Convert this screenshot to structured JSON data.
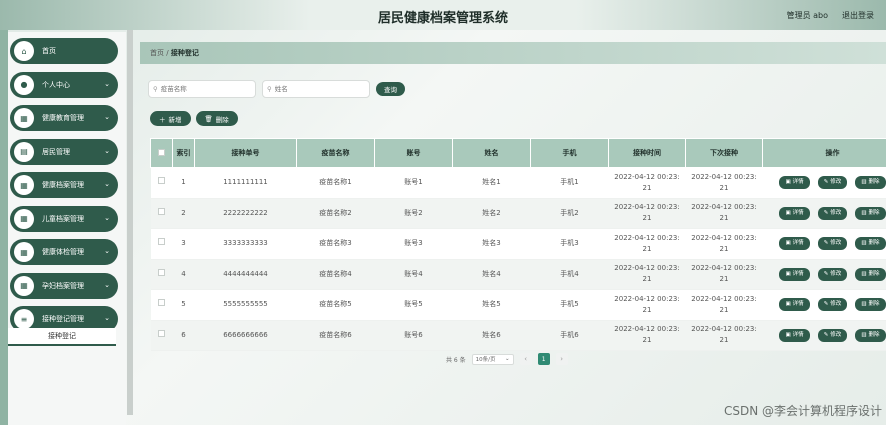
{
  "header": {
    "title": "居民健康档案管理系统",
    "user": "管理员 abo",
    "logout": "退出登录"
  },
  "sidebar": {
    "items": [
      {
        "label": "首页",
        "icon": "home-icon",
        "glyph": "⌂",
        "chevron": false
      },
      {
        "label": "个人中心",
        "icon": "user-icon",
        "glyph": "●",
        "chevron": true
      },
      {
        "label": "健康教育管理",
        "icon": "grid-icon",
        "glyph": "▦",
        "chevron": true
      },
      {
        "label": "居民管理",
        "icon": "doc-icon",
        "glyph": "▤",
        "chevron": true
      },
      {
        "label": "健康档案管理",
        "icon": "grid-icon",
        "glyph": "▦",
        "chevron": true
      },
      {
        "label": "儿童档案管理",
        "icon": "grid-icon",
        "glyph": "▦",
        "chevron": true
      },
      {
        "label": "健康体检管理",
        "icon": "grid-icon",
        "glyph": "▦",
        "chevron": true
      },
      {
        "label": "孕妇档案管理",
        "icon": "grid-icon",
        "glyph": "▦",
        "chevron": true
      },
      {
        "label": "接种登记管理",
        "icon": "list-icon",
        "glyph": "≡",
        "chevron": true
      }
    ],
    "submenu": "接种登记"
  },
  "breadcrumb": {
    "home": "首页",
    "sep": "/",
    "current": "接种登记"
  },
  "search": {
    "vaccine_placeholder": "疫苗名称",
    "name_placeholder": "姓名",
    "button": "查询"
  },
  "actions": {
    "add": "新增",
    "delete": "删除"
  },
  "table": {
    "headers": [
      "索引",
      "接种单号",
      "疫苗名称",
      "账号",
      "姓名",
      "手机",
      "接种时间",
      "下次接种",
      "操作"
    ],
    "rows": [
      {
        "idx": "1",
        "no": "1111111111",
        "vaccine": "疫苗名称1",
        "account": "账号1",
        "name": "姓名1",
        "phone": "手机1",
        "time1": "2022-04-12 00:23:",
        "time2": "21",
        "next1": "2022-04-12 00:23:",
        "next2": "21"
      },
      {
        "idx": "2",
        "no": "2222222222",
        "vaccine": "疫苗名称2",
        "account": "账号2",
        "name": "姓名2",
        "phone": "手机2",
        "time1": "2022-04-12 00:23:",
        "time2": "21",
        "next1": "2022-04-12 00:23:",
        "next2": "21"
      },
      {
        "idx": "3",
        "no": "3333333333",
        "vaccine": "疫苗名称3",
        "account": "账号3",
        "name": "姓名3",
        "phone": "手机3",
        "time1": "2022-04-12 00:23:",
        "time2": "21",
        "next1": "2022-04-12 00:23:",
        "next2": "21"
      },
      {
        "idx": "4",
        "no": "4444444444",
        "vaccine": "疫苗名称4",
        "account": "账号4",
        "name": "姓名4",
        "phone": "手机4",
        "time1": "2022-04-12 00:23:",
        "time2": "21",
        "next1": "2022-04-12 00:23:",
        "next2": "21"
      },
      {
        "idx": "5",
        "no": "5555555555",
        "vaccine": "疫苗名称5",
        "account": "账号5",
        "name": "姓名5",
        "phone": "手机5",
        "time1": "2022-04-12 00:23:",
        "time2": "21",
        "next1": "2022-04-12 00:23:",
        "next2": "21"
      },
      {
        "idx": "6",
        "no": "6666666666",
        "vaccine": "疫苗名称6",
        "account": "账号6",
        "name": "姓名6",
        "phone": "手机6",
        "time1": "2022-04-12 00:23:",
        "time2": "21",
        "next1": "2022-04-12 00:23:",
        "next2": "21"
      }
    ],
    "row_ops": {
      "detail": "详情",
      "edit": "修改",
      "delete": "删除"
    }
  },
  "pagination": {
    "total": "共 6 条",
    "page_size": "10条/页",
    "current_page": "1",
    "prev": "‹",
    "next": "›"
  },
  "watermark": "CSDN @李会计算机程序设计",
  "colors": {
    "primary": "#2f5b4b",
    "header_bg": "#a9c9bb",
    "page_active": "#2f8a73"
  }
}
